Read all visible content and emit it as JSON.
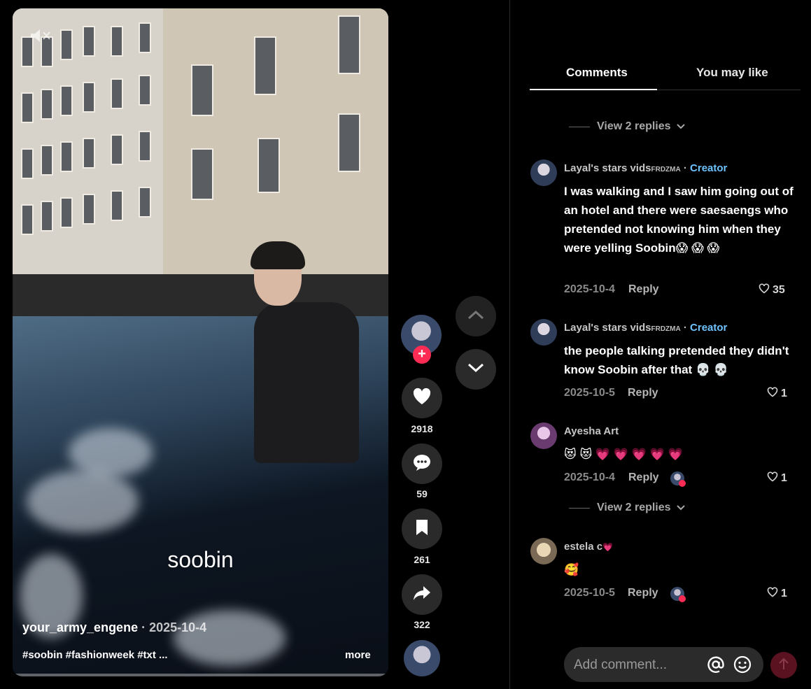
{
  "video": {
    "overlay_text": "soobin",
    "author": "your_army_engene",
    "date": "2025-10-4",
    "tags": "#soobin #fashionweek #txt ...",
    "more_label": "more"
  },
  "actions": {
    "likes": "2918",
    "comments": "59",
    "saves": "261",
    "shares": "322",
    "follow_symbol": "+"
  },
  "tabs": [
    {
      "label": "Comments",
      "active": true
    },
    {
      "label": "You may like",
      "active": false
    }
  ],
  "view_replies_label": "View 2 replies",
  "comments": [
    {
      "author": "Layal's stars vids",
      "author_suffix": "FRDZMA",
      "separator": "·",
      "badge": "Creator",
      "text": "I was walking and I saw him going out of an hotel and there were saesaengs who pretended not knowing him when they were yelling Soobin😱 😱 😱",
      "date": "2025-10-4",
      "reply_label": "Reply",
      "likes": "35"
    },
    {
      "author": "Layal's stars vids",
      "author_suffix": "FRDZMA",
      "separator": "·",
      "badge": "Creator",
      "text": "the people talking pretended they didn't know Soobin after that 💀 💀",
      "date": "2025-10-5",
      "reply_label": "Reply",
      "likes": "1"
    },
    {
      "author": "Ayesha Art",
      "text": "😻 😻 💗 💗 💗 💗 💗",
      "date": "2025-10-4",
      "reply_label": "Reply",
      "likes": "1"
    },
    {
      "author": "estela c",
      "author_emoji": "💗",
      "text": "🥰",
      "date": "2025-10-5",
      "reply_label": "Reply",
      "likes": "1"
    }
  ],
  "comment_input": {
    "placeholder": "Add comment..."
  },
  "colors": {
    "accent": "#fe2c55",
    "creator_badge": "#6ec3ff",
    "background": "#000000"
  },
  "icons": [
    "mute-icon",
    "heart-icon",
    "comment-icon",
    "bookmark-icon",
    "share-icon",
    "chevron-up-icon",
    "chevron-down-icon",
    "at-icon",
    "emoji-icon",
    "send-arrow-icon"
  ]
}
